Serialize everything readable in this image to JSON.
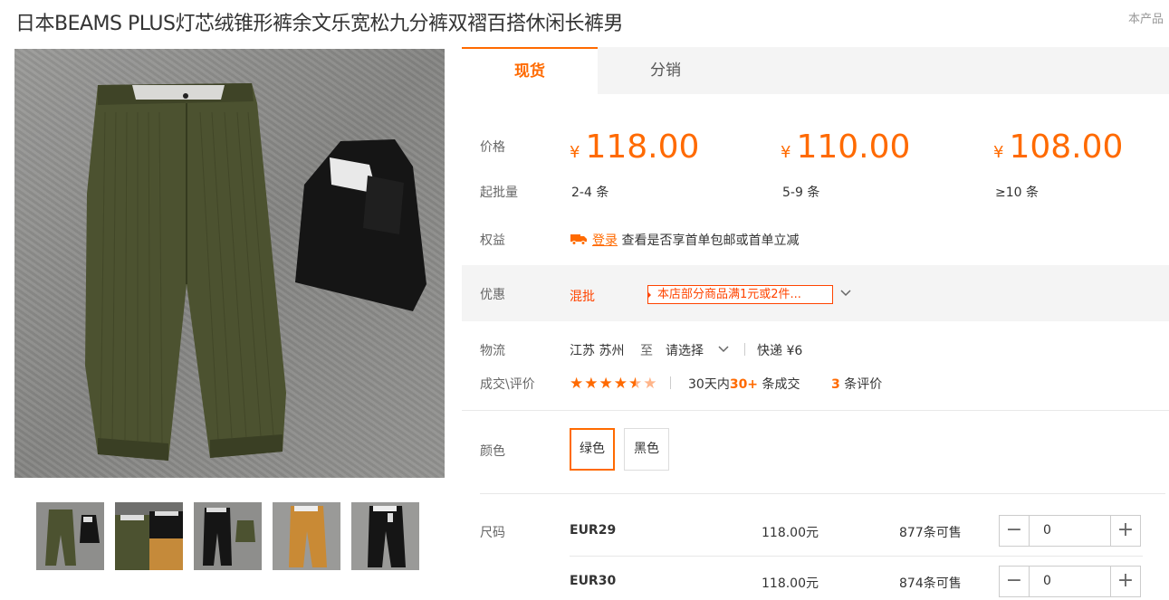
{
  "title": "日本BEAMS PLUS灯芯绒锥形裤余文乐宽松九分裤双褶百搭休闲长裤男",
  "corner_link": "本产品",
  "tabs": [
    "现货",
    "分销"
  ],
  "labels": {
    "price": "价格",
    "moq": "起批量",
    "rights": "权益",
    "promo": "优惠",
    "logistics": "物流",
    "deals": "成交\\评价",
    "color": "颜色",
    "size": "尺码"
  },
  "price_tiers": [
    {
      "currency": "¥",
      "price": "118.00",
      "range": "2-4",
      "unit": "条"
    },
    {
      "currency": "¥",
      "price": "110.00",
      "range": "5-9",
      "unit": "条"
    },
    {
      "currency": "¥",
      "price": "108.00",
      "range": "≥10",
      "unit": "条"
    }
  ],
  "rights": {
    "login": "登录",
    "text": "查看是否享首单包邮或首单立减"
  },
  "promo": {
    "type": "混批",
    "tag": "本店部分商品满1元或2件..."
  },
  "logistics": {
    "from": "江苏 苏州",
    "to_word": "至",
    "select": "请选择",
    "shipping": "快递 ¥6"
  },
  "deals": {
    "rating": 4.5,
    "stars_on": "★★★★",
    "stars_half": "★",
    "stars_off": "★",
    "prefix": "30天内",
    "count": "30+",
    "suffix": "条成交",
    "reviews": "3",
    "reviews_suffix": "条评价"
  },
  "colors": [
    {
      "label": "绿色",
      "selected": true
    },
    {
      "label": "黑色",
      "selected": false
    }
  ],
  "sizes": [
    {
      "size": "EUR29",
      "price": "118.00元",
      "stock": "877",
      "stock_suffix": "条可售",
      "qty": "0"
    },
    {
      "size": "EUR30",
      "price": "118.00元",
      "stock": "874",
      "stock_suffix": "条可售",
      "qty": "0"
    }
  ],
  "stepper": {
    "minus": "−",
    "plus": "+"
  },
  "colors_accent": {
    "brand": "#ff6a00",
    "promo": "#ff4400"
  }
}
